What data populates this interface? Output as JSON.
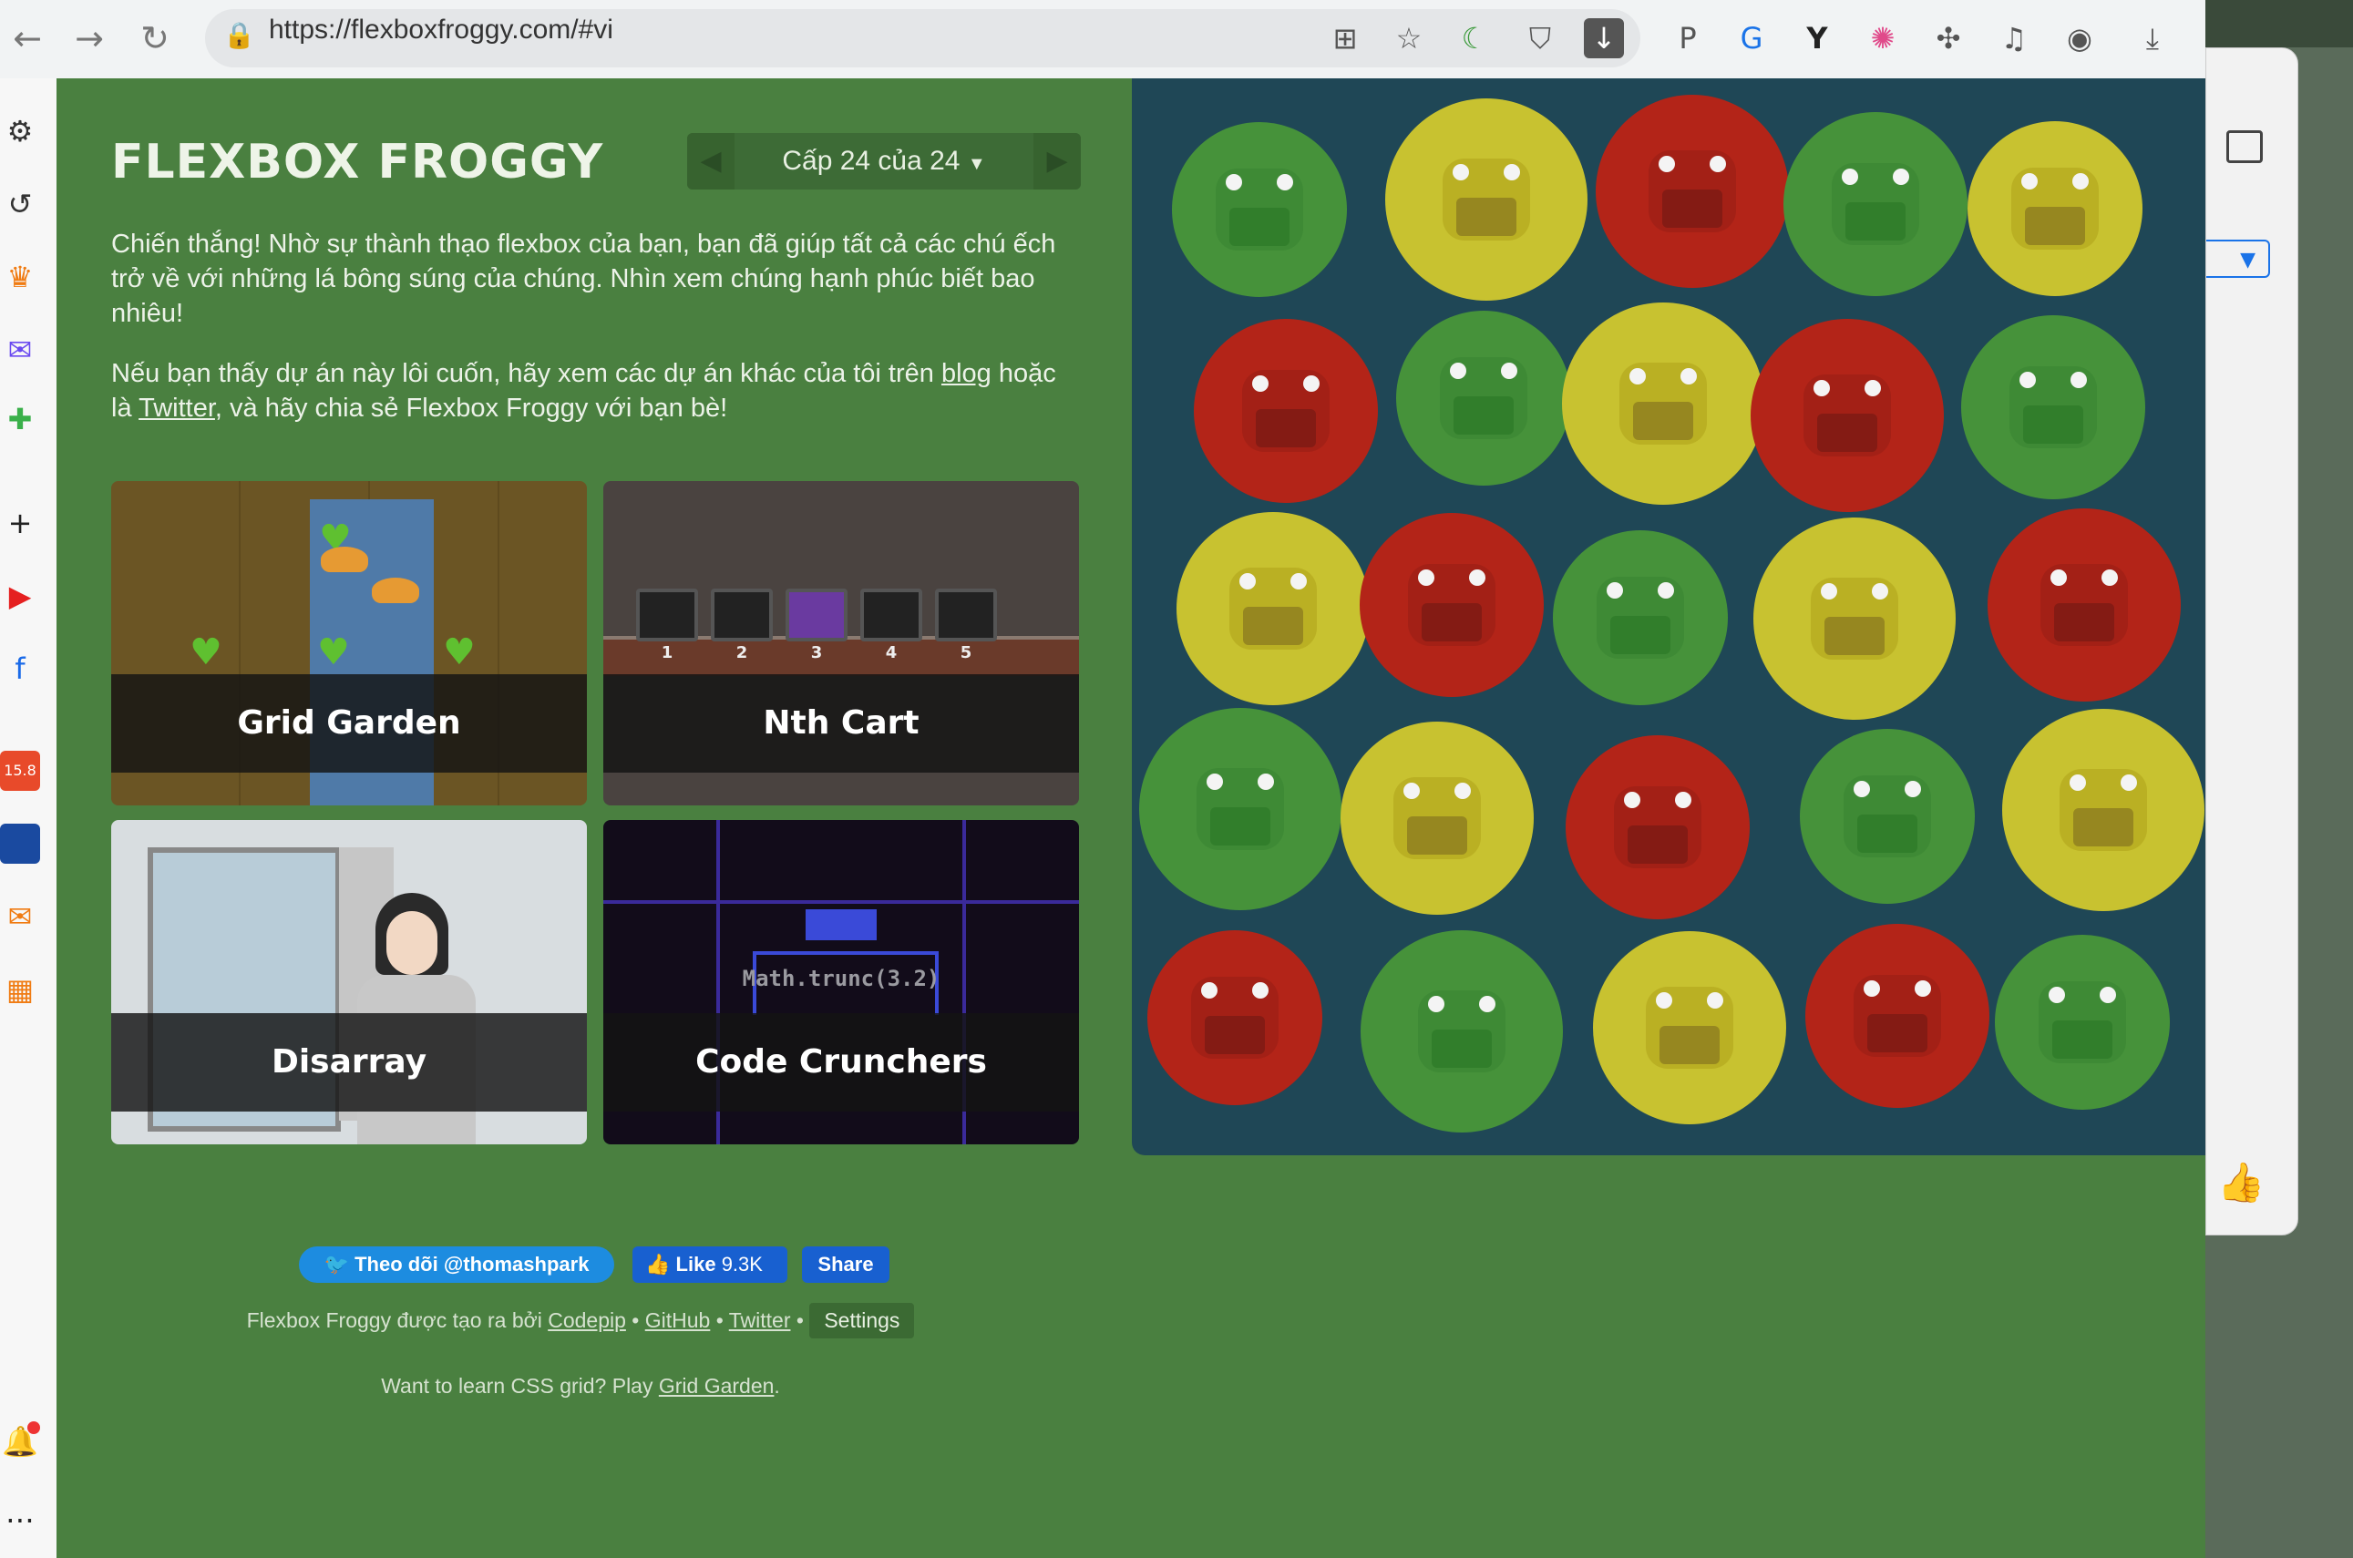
{
  "browser": {
    "url": "https://flexboxfroggy.com/#vi",
    "back_icon": "arrow-left-icon",
    "forward_icon": "arrow-right-icon",
    "reload_icon": "reload-icon"
  },
  "page": {
    "title": "FLEXBOX FROGGY",
    "level_label": "Cấp 24 của 24",
    "win_text": "Chiến thắng! Nhờ sự thành thạo flexbox của bạn, bạn đã giúp tất cả các chú ếch trở về với những lá bông súng của chúng. Nhìn xem chúng hạnh phúc biết bao nhiêu!",
    "promo_before": "Nếu bạn thấy dự án này lôi cuốn, hãy xem các dự án khác của tôi trên ",
    "promo_blog": "blog",
    "promo_mid": " hoặc là ",
    "promo_twitter": "Twitter",
    "promo_after": ", và hãy chia sẻ Flexbox Froggy với bạn bè!",
    "cards": [
      {
        "label": "Grid Garden"
      },
      {
        "label": "Nth Cart"
      },
      {
        "label": "Disarray"
      },
      {
        "label": "Code Crunchers"
      }
    ],
    "code_sample": "Math.trunc(3.2)",
    "cart_numbers": [
      "1",
      "2",
      "3",
      "4",
      "5"
    ],
    "social": {
      "twitter_follow": "Theo dõi @thomashpark",
      "like": "Like",
      "like_count": "9.3K",
      "share": "Share"
    },
    "footer": {
      "created_by": "Flexbox Froggy được tạo ra bởi ",
      "codepip": "Codepip",
      "github": "GitHub",
      "twitter": "Twitter",
      "settings": "Settings",
      "grid_prompt": "Want to learn CSS grid? Play ",
      "grid_link": "Grid Garden",
      "grid_end": "."
    }
  },
  "pond": {
    "rows": [
      [
        "green",
        "yellow",
        "red",
        "green",
        "yellow"
      ],
      [
        "red",
        "green",
        "yellow",
        "red",
        "green"
      ],
      [
        "yellow",
        "red",
        "green",
        "yellow",
        "red"
      ],
      [
        "green",
        "yellow",
        "red",
        "green",
        "yellow"
      ],
      [
        "red",
        "green",
        "yellow",
        "red",
        "green"
      ]
    ]
  },
  "colors": {
    "green": "#3e8a35",
    "yellow": "#c6c02a",
    "red": "#b42318",
    "page_bg": "#4a8040",
    "pond_bg": "#1f4756"
  },
  "sidebar": {
    "badge": "15.8"
  }
}
